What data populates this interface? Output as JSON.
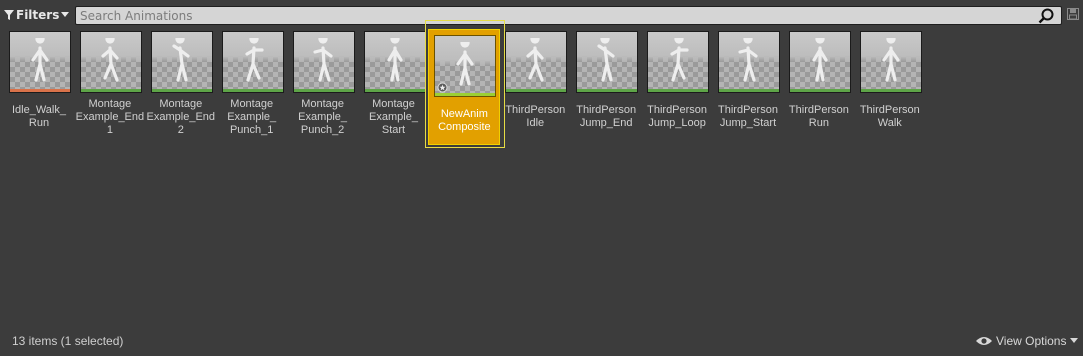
{
  "toolbar": {
    "filters_label": "Filters",
    "search_placeholder": "Search Animations"
  },
  "colors": {
    "background": "#3c3c3c",
    "selection": "#e2a000",
    "selection_outline": "#e6dc45",
    "bar_orange": "#d9724a",
    "bar_green": "#5ea548"
  },
  "assets": [
    {
      "label": "Idle_Walk_\nRun",
      "bar": "orange",
      "selected": false
    },
    {
      "label": "Montage\nExample_End\n1",
      "bar": "green",
      "selected": false
    },
    {
      "label": "Montage\nExample_End\n2",
      "bar": "green",
      "selected": false
    },
    {
      "label": "Montage\nExample_\nPunch_1",
      "bar": "green",
      "selected": false
    },
    {
      "label": "Montage\nExample_\nPunch_2",
      "bar": "green",
      "selected": false
    },
    {
      "label": "Montage\nExample_\nStart",
      "bar": "green",
      "selected": false
    },
    {
      "label": "NewAnim\nComposite",
      "bar": "lime",
      "selected": true
    },
    {
      "label": "ThirdPerson\nIdle",
      "bar": "green",
      "selected": false
    },
    {
      "label": "ThirdPerson\nJump_End",
      "bar": "green",
      "selected": false
    },
    {
      "label": "ThirdPerson\nJump_Loop",
      "bar": "green",
      "selected": false
    },
    {
      "label": "ThirdPerson\nJump_Start",
      "bar": "green",
      "selected": false
    },
    {
      "label": "ThirdPerson\nRun",
      "bar": "green",
      "selected": false
    },
    {
      "label": "ThirdPerson\nWalk",
      "bar": "green",
      "selected": false
    }
  ],
  "status": {
    "item_count": "13 items (1 selected)",
    "view_options_label": "View Options"
  }
}
